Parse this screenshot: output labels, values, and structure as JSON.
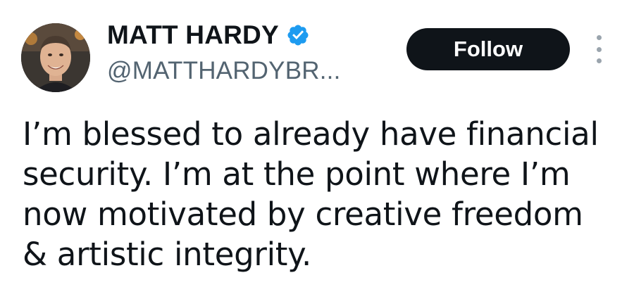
{
  "author": {
    "display_name": "MATT HARDY",
    "handle": "@MATTHARDYBR...",
    "verified": true,
    "avatar_icon": "profile-photo"
  },
  "actions": {
    "follow_label": "Follow",
    "more_icon": "vertical-ellipsis-icon"
  },
  "tweet": {
    "text": "I’m blessed to already have financial\nsecurity. I’m at the point where I’m\nnow motivated by creative freedom\n& artistic integrity."
  },
  "colors": {
    "text": "#0f1419",
    "secondary_text": "#536471",
    "verified_badge": "#1d9bf0",
    "follow_button_bg": "#0f1419",
    "follow_button_text": "#ffffff"
  }
}
